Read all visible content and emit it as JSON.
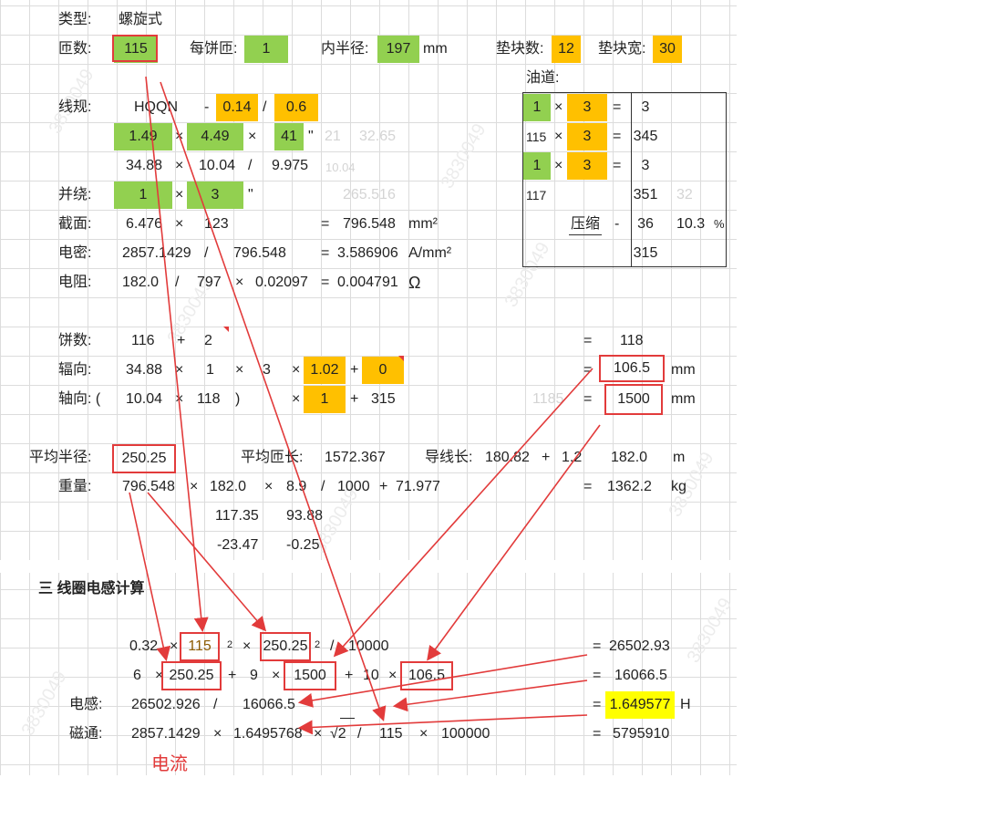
{
  "labels": {
    "type_label": "类型:",
    "type_value": "螺旋式",
    "turns_label": "匝数:",
    "turns_value": "115",
    "per_cake_label": "每饼匝:",
    "per_cake_value": "1",
    "inner_radius_label": "内半径:",
    "inner_radius_value": "197",
    "inner_radius_unit": "mm",
    "spacer_count_label": "垫块数:",
    "spacer_count_value": "12",
    "spacer_width_label": "垫块宽:",
    "spacer_width_value": "30",
    "oil_label": "油道:",
    "wire_label": "线规:",
    "wire_type": "HQQN",
    "dash": "-",
    "wire_v1": "0.14",
    "slash": "/",
    "wire_v2": "0.6",
    "parallel_label": "并绕:",
    "section_label": "截面:",
    "current_density_label": "电密:",
    "resistance_label": "电阻:",
    "cakes_label": "饼数:",
    "radial_label": "辐向:",
    "axial_label": "轴向: (",
    "avg_radius_label": "平均半径:",
    "avg_turn_label": "平均匝长:",
    "wire_length_label": "导线长:",
    "weight_label": "重量:",
    "section3_title": "三  线圈电感计算",
    "inductance_label": "电感:",
    "flux_label": "磁通:",
    "current_note": "电流"
  },
  "rows": {
    "wire_row2": [
      "1.49",
      "×",
      "4.49",
      "×",
      "41",
      "\"",
      "21",
      "32.65"
    ],
    "wire_row3": [
      "34.88",
      "×",
      "10.04",
      "/",
      "9.975",
      "10.04"
    ],
    "parallel": [
      "1",
      "×",
      "3",
      "\"",
      "265.516"
    ],
    "section": [
      "6.476",
      "×",
      "123",
      "=",
      "796.548",
      "mm²"
    ],
    "current_density": [
      "2857.1429",
      "/",
      "796.548",
      "=",
      "3.586906",
      "A/mm²"
    ],
    "resistance": [
      "182.0",
      "/",
      "797",
      "×",
      "0.02097",
      "=",
      "0.004791",
      "Ω"
    ],
    "cakes": [
      "116",
      "+",
      "2",
      "=",
      "118"
    ],
    "radial": [
      "34.88",
      "×",
      "1",
      "×",
      "3",
      "×",
      "1.02",
      "+",
      "0",
      "=",
      "106.5",
      "mm"
    ],
    "axial": [
      "10.04",
      "×",
      "118",
      ")",
      "×",
      "1",
      "+",
      "315",
      "1185",
      "=",
      "1500",
      "mm"
    ],
    "avg": [
      "250.25",
      "1572.367",
      "180.82",
      "+",
      "1.2",
      "182.0",
      "m"
    ],
    "weight": [
      "796.548",
      "×",
      "182.0",
      "×",
      "8.9",
      "/",
      "1000",
      "+",
      "71.977",
      "=",
      "1362.2",
      "kg"
    ],
    "extra1": [
      "117.35",
      "93.88"
    ],
    "extra2": [
      "-23.47",
      "-0.25"
    ],
    "calc1": [
      "0.32",
      "×",
      "115",
      "2",
      "×",
      "250.25",
      "2",
      "/",
      "10000",
      "=",
      "26502.93"
    ],
    "calc2": [
      "6",
      "×",
      "250.25",
      "+",
      "9",
      "×",
      "1500",
      "+",
      "10",
      "×",
      "106.5",
      "=",
      "16066.5"
    ],
    "inductance": [
      "26502.926",
      "/",
      "16066.5",
      "=",
      "1.649577",
      "H"
    ],
    "flux": [
      "2857.1429",
      "×",
      "1.6495768",
      "×",
      "√2",
      "/",
      "115",
      "×",
      "100000",
      "=",
      "5795910"
    ]
  },
  "oil": {
    "r1": [
      "1",
      "×",
      "3",
      "=",
      "3"
    ],
    "r2": [
      "115",
      "×",
      "3",
      "=",
      "345"
    ],
    "r3": [
      "1",
      "×",
      "3",
      "=",
      "3"
    ],
    "r4": [
      "117",
      "351",
      "32"
    ],
    "r5": [
      "压缩",
      "-",
      "36",
      "10.3",
      "%"
    ],
    "r6": [
      "315"
    ]
  },
  "watermark_text": "3830049",
  "colors": {
    "green": "#92d050",
    "orange": "#ffc000",
    "yellow": "#ffff00",
    "annotation_red": "#e23b3b"
  }
}
